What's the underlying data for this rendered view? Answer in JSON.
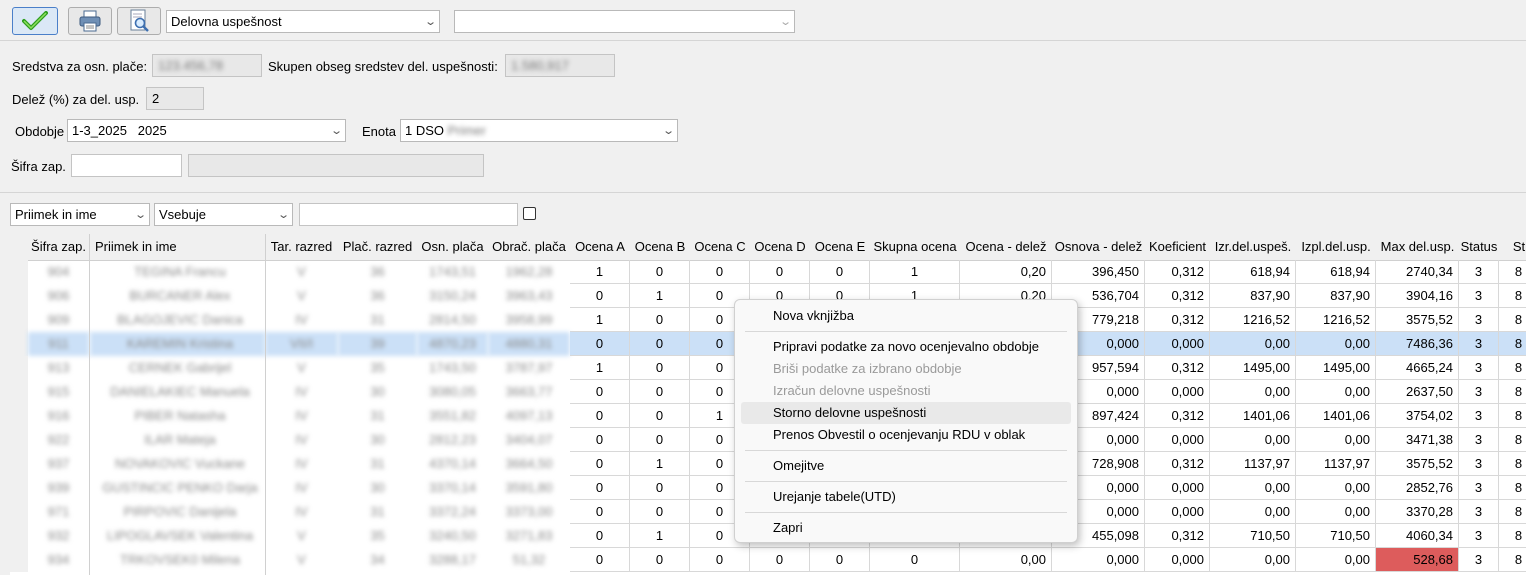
{
  "toolbar": {
    "report_select": "Delovna uspešnost",
    "second_select": ""
  },
  "form": {
    "sredstva_label": "Sredstva za osn. plače:",
    "sredstva_value": "123.456,78",
    "skupen_label": "Skupen obseg sredstev del. uspešnosti:",
    "skupen_value": "1.580,917",
    "delez_label": "Delež (%) za del. usp.",
    "delez_value": "2",
    "obdobje_label": "Obdobje",
    "obdobje_value": "1-3_2025   2025",
    "enota_label": "Enota",
    "enota_value": "1 DSO",
    "enota_blur": "Primer",
    "sifra_label": "Šifra zap.",
    "sifra_value": "",
    "sifra_name": ""
  },
  "filter": {
    "column": "Priimek in ime",
    "operator": "Vsebuje",
    "text": ""
  },
  "table": {
    "columns": [
      "Šifra zap.",
      "Priimek in ime",
      "Tar. razred",
      "Plač. razred",
      "Osn. plača",
      "Obrač. plača",
      "Ocena A",
      "Ocena B",
      "Ocena C",
      "Ocena D",
      "Ocena E",
      "Skupna ocena",
      "Ocena - delež",
      "Osnova - delež",
      "Koeficient",
      "Izr.del.uspeš.",
      "Izpl.del.usp.",
      "Max del.usp.",
      "Status",
      "St"
    ],
    "rows": [
      {
        "sifra": "904",
        "ime": "TEGINA Francu",
        "tar": "V",
        "plac": "36",
        "osn": "1743,51",
        "obr": "1962,28",
        "a": "1",
        "b": "0",
        "c": "0",
        "d": "0",
        "e": "0",
        "skupna": "1",
        "od": "0,20",
        "osd": "396,450",
        "koef": "0,312",
        "izr": "618,94",
        "izpl": "618,94",
        "max": "2740,34",
        "status": "3",
        "st": "8"
      },
      {
        "sifra": "906",
        "ime": "BURCANER Alex",
        "tar": "V",
        "plac": "36",
        "osn": "3150,24",
        "obr": "3963,43",
        "a": "0",
        "b": "1",
        "c": "0",
        "d": "0",
        "e": "0",
        "skupna": "1",
        "od": "0,20",
        "osd": "536,704",
        "koef": "0,312",
        "izr": "837,90",
        "izpl": "837,90",
        "max": "3904,16",
        "status": "3",
        "st": "8"
      },
      {
        "sifra": "909",
        "ime": "BLAGOJEVIC Danica",
        "tar": "IV",
        "plac": "31",
        "osn": "2814,50",
        "obr": "3958,99",
        "a": "1",
        "b": "0",
        "c": "0",
        "d": "",
        "e": "",
        "skupna": "",
        "od": "",
        "osd": "779,218",
        "koef": "0,312",
        "izr": "1216,52",
        "izpl": "1216,52",
        "max": "3575,52",
        "status": "3",
        "st": "8"
      },
      {
        "sifra": "911",
        "ime": "KAREMIN Kristina",
        "tar": "VII/I",
        "plac": "39",
        "osn": "4870,23",
        "obr": "4880,31",
        "a": "0",
        "b": "0",
        "c": "0",
        "d": "",
        "e": "",
        "skupna": "",
        "od": "",
        "osd": "0,000",
        "koef": "0,000",
        "izr": "0,00",
        "izpl": "0,00",
        "max": "7486,36",
        "status": "3",
        "st": "8"
      },
      {
        "sifra": "913",
        "ime": "CERNEK Gabrijel",
        "tar": "V",
        "plac": "35",
        "osn": "1743,50",
        "obr": "3787,97",
        "a": "1",
        "b": "0",
        "c": "0",
        "d": "",
        "e": "",
        "skupna": "",
        "od": "",
        "osd": "957,594",
        "koef": "0,312",
        "izr": "1495,00",
        "izpl": "1495,00",
        "max": "4665,24",
        "status": "3",
        "st": "8"
      },
      {
        "sifra": "915",
        "ime": "DANIELAKIEC Manuela",
        "tar": "IV",
        "plac": "30",
        "osn": "3080,05",
        "obr": "3663,77",
        "a": "0",
        "b": "0",
        "c": "0",
        "d": "",
        "e": "",
        "skupna": "",
        "od": "",
        "osd": "0,000",
        "koef": "0,000",
        "izr": "0,00",
        "izpl": "0,00",
        "max": "2637,50",
        "status": "3",
        "st": "8"
      },
      {
        "sifra": "916",
        "ime": "PIBER Natasha",
        "tar": "IV",
        "plac": "31",
        "osn": "3551,82",
        "obr": "4097,13",
        "a": "0",
        "b": "0",
        "c": "1",
        "d": "",
        "e": "",
        "skupna": "",
        "od": "",
        "osd": "897,424",
        "koef": "0,312",
        "izr": "1401,06",
        "izpl": "1401,06",
        "max": "3754,02",
        "status": "3",
        "st": "8"
      },
      {
        "sifra": "922",
        "ime": "ILAR Mateja",
        "tar": "IV",
        "plac": "30",
        "osn": "2812,23",
        "obr": "3404,07",
        "a": "0",
        "b": "0",
        "c": "0",
        "d": "",
        "e": "",
        "skupna": "",
        "od": "",
        "osd": "0,000",
        "koef": "0,000",
        "izr": "0,00",
        "izpl": "0,00",
        "max": "3471,38",
        "status": "3",
        "st": "8"
      },
      {
        "sifra": "937",
        "ime": "NOVAKOVIC Vuckane",
        "tar": "IV",
        "plac": "31",
        "osn": "4370,14",
        "obr": "3664,50",
        "a": "0",
        "b": "1",
        "c": "0",
        "d": "",
        "e": "",
        "skupna": "",
        "od": "",
        "osd": "728,908",
        "koef": "0,312",
        "izr": "1137,97",
        "izpl": "1137,97",
        "max": "3575,52",
        "status": "3",
        "st": "8"
      },
      {
        "sifra": "939",
        "ime": "GUSTINCIC PENKO Darja",
        "tar": "IV",
        "plac": "30",
        "osn": "3370,14",
        "obr": "3591,80",
        "a": "0",
        "b": "0",
        "c": "0",
        "d": "",
        "e": "",
        "skupna": "",
        "od": "",
        "osd": "0,000",
        "koef": "0,000",
        "izr": "0,00",
        "izpl": "0,00",
        "max": "2852,76",
        "status": "3",
        "st": "8"
      },
      {
        "sifra": "971",
        "ime": "PIRPOVIC Danijela",
        "tar": "IV",
        "plac": "31",
        "osn": "3372,24",
        "obr": "3373,00",
        "a": "0",
        "b": "0",
        "c": "0",
        "d": "",
        "e": "",
        "skupna": "",
        "od": "",
        "osd": "0,000",
        "koef": "0,000",
        "izr": "0,00",
        "izpl": "0,00",
        "max": "3370,28",
        "status": "3",
        "st": "8"
      },
      {
        "sifra": "932",
        "ime": "LIPOGLAVSEK Valentina",
        "tar": "V",
        "plac": "35",
        "osn": "3240,50",
        "obr": "3271,83",
        "a": "0",
        "b": "1",
        "c": "0",
        "d": "",
        "e": "",
        "skupna": "",
        "od": "",
        "osd": "455,098",
        "koef": "0,312",
        "izr": "710,50",
        "izpl": "710,50",
        "max": "4060,34",
        "status": "3",
        "st": "8"
      },
      {
        "sifra": "934",
        "ime": "TRKOVSEK0 Milena",
        "tar": "V",
        "plac": "34",
        "osn": "3288,17",
        "obr": "51,32",
        "a": "0",
        "b": "0",
        "c": "0",
        "d": "0",
        "e": "0",
        "skupna": "0",
        "od": "0,00",
        "osd": "0,000",
        "koef": "0,000",
        "izr": "0,00",
        "izpl": "0,00",
        "max": "528,68",
        "status": "3",
        "st": "8"
      }
    ]
  },
  "context_menu": {
    "items": [
      {
        "label": "Nova vknjižba"
      },
      {
        "label": "Pripravi podatke za novo ocenjevalno obdobje"
      },
      {
        "label": "Briši podatke za izbrano obdobje"
      },
      {
        "label": "Izračun delovne uspešnosti"
      },
      {
        "label": "Storno delovne uspešnosti"
      },
      {
        "label": "Prenos Obvestil o ocenjevanju RDU v oblak"
      },
      {
        "label": "Omejitve"
      },
      {
        "label": "Urejanje tabele(UTD)"
      },
      {
        "label": "Zapri"
      }
    ]
  },
  "colors": {
    "selected_row": "#cbe0f7",
    "max_highlight": "#dd5c5c"
  }
}
